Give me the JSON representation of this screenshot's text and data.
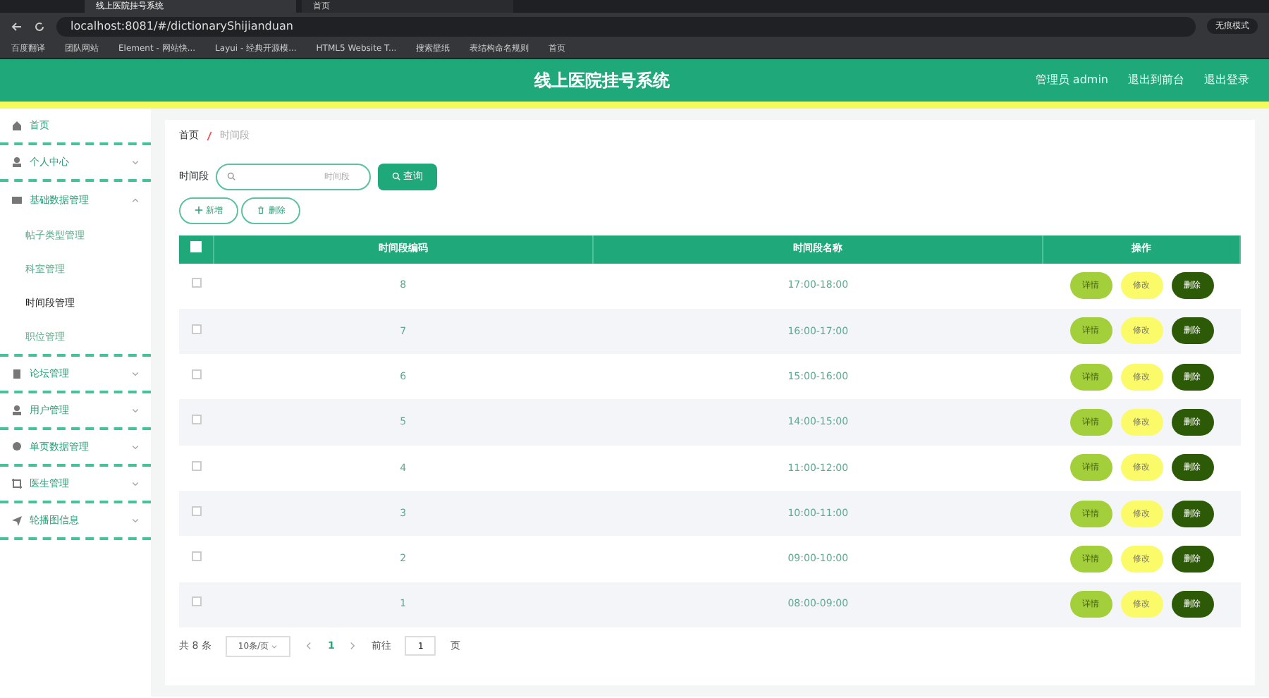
{
  "browser": {
    "tabs": [
      {
        "title": "线上医院挂号系统",
        "selected": true
      },
      {
        "title": "首页",
        "selected": false
      }
    ],
    "address": "localhost:8081/#/dictionaryShijianduan",
    "profile": "无痕模式",
    "bookmarks": [
      "百度翻译",
      "团队网站",
      "Element - 网站快...",
      "Layui - 经典开源模...",
      "HTML5 Website T...",
      "搜索壁纸",
      "表结构命名规则",
      "首页"
    ]
  },
  "header": {
    "title": "线上医院挂号系统",
    "links": [
      "管理员 admin",
      "退出到前台",
      "退出登录"
    ]
  },
  "sidebar": {
    "items": [
      {
        "label": "首页"
      },
      {
        "label": "个人中心",
        "expanded": false
      },
      {
        "label": "基础数据管理",
        "expanded": true,
        "children": [
          {
            "label": "帖子类型管理",
            "selected": false
          },
          {
            "label": "科室管理",
            "selected": false
          },
          {
            "label": "时间段管理",
            "selected": true
          },
          {
            "label": "职位管理",
            "selected": false
          }
        ]
      },
      {
        "label": "论坛管理",
        "expanded": false
      },
      {
        "label": "用户管理",
        "expanded": false
      },
      {
        "label": "单页数据管理",
        "expanded": false
      },
      {
        "label": "医生管理",
        "expanded": false
      },
      {
        "label": "轮播图信息",
        "expanded": false
      }
    ]
  },
  "breadcrumb": [
    "首页",
    "时间段"
  ],
  "search": {
    "label": "时间段",
    "placeholder": "时间段",
    "button": "查询"
  },
  "actions": [
    "新增",
    "删除"
  ],
  "table": {
    "columns": [
      "时间段编码",
      "时间段名称",
      "操作"
    ],
    "all_checked": false,
    "rows": [
      {
        "code": "8",
        "name": "17:00-18:00",
        "checked": false,
        "buttons": [
          "详情",
          "修改",
          "删除"
        ]
      },
      {
        "code": "7",
        "name": "16:00-17:00",
        "checked": false,
        "buttons": [
          "详情",
          "修改",
          "删除"
        ]
      },
      {
        "code": "6",
        "name": "15:00-16:00",
        "checked": false,
        "buttons": [
          "详情",
          "修改",
          "删除"
        ]
      },
      {
        "code": "5",
        "name": "14:00-15:00",
        "checked": false,
        "buttons": [
          "详情",
          "修改",
          "删除"
        ]
      },
      {
        "code": "4",
        "name": "11:00-12:00",
        "checked": false,
        "buttons": [
          "详情",
          "修改",
          "删除"
        ]
      },
      {
        "code": "3",
        "name": "10:00-11:00",
        "checked": false,
        "buttons": [
          "详情",
          "修改",
          "删除"
        ]
      },
      {
        "code": "2",
        "name": "09:00-10:00",
        "checked": false,
        "buttons": [
          "详情",
          "修改",
          "删除"
        ]
      },
      {
        "code": "1",
        "name": "08:00-09:00",
        "checked": false,
        "buttons": [
          "详情",
          "修改",
          "删除"
        ]
      }
    ]
  },
  "pagination": {
    "total": "共 8 条",
    "page_size": "10条/页",
    "pages": [
      {
        "label": "1",
        "selected": true
      }
    ],
    "goto_label": "前往",
    "goto_value": "1",
    "goto_suffix": "页"
  }
}
